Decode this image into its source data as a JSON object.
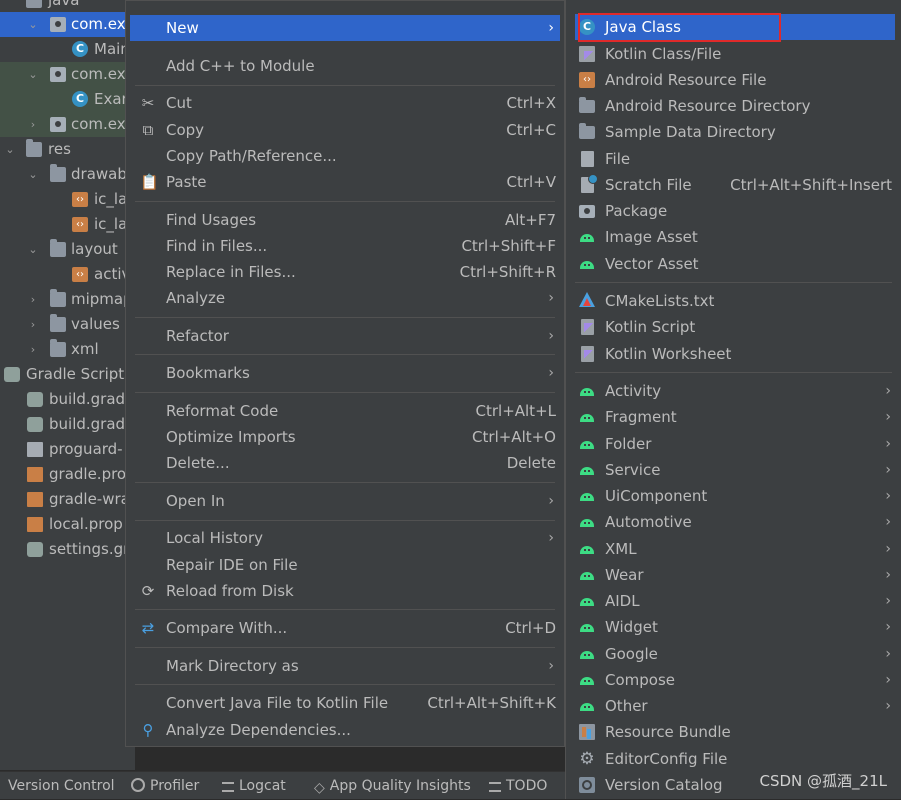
{
  "tree": {
    "rows": [
      {
        "label": "java",
        "indent": 0
      },
      {
        "label": "com.ex",
        "indent": 1
      },
      {
        "label": "Main",
        "indent": 2
      },
      {
        "label": "com.ex",
        "indent": 1
      },
      {
        "label": "Exan",
        "indent": 2
      },
      {
        "label": "com.ex",
        "indent": 1
      },
      {
        "label": "res",
        "indent": 0
      },
      {
        "label": "drawab",
        "indent": 1
      },
      {
        "label": "ic_la",
        "indent": 2
      },
      {
        "label": "ic_la",
        "indent": 2
      },
      {
        "label": "layout",
        "indent": 1
      },
      {
        "label": "activ",
        "indent": 2
      },
      {
        "label": "mipmap",
        "indent": 1
      },
      {
        "label": "values",
        "indent": 1
      },
      {
        "label": "xml",
        "indent": 1
      },
      {
        "label": "Gradle Scripts",
        "indent": 0
      },
      {
        "label": "build.grad",
        "indent": 1
      },
      {
        "label": "build.grad",
        "indent": 1
      },
      {
        "label": "proguard-",
        "indent": 1
      },
      {
        "label": "gradle.pro",
        "indent": 1
      },
      {
        "label": "gradle-wra",
        "indent": 1
      },
      {
        "label": "local.prop",
        "indent": 1
      },
      {
        "label": "settings.gr",
        "indent": 1
      }
    ]
  },
  "menu": {
    "new": "New",
    "add_cpp": "Add C++ to Module",
    "cut": "Cut",
    "cut_sc": "Ctrl+X",
    "copy": "Copy",
    "copy_sc": "Ctrl+C",
    "copy_path": "Copy Path/Reference...",
    "paste": "Paste",
    "paste_sc": "Ctrl+V",
    "find_usages": "Find Usages",
    "find_usages_sc": "Alt+F7",
    "find_in_files": "Find in Files...",
    "find_in_files_sc": "Ctrl+Shift+F",
    "replace_in_files": "Replace in Files...",
    "replace_in_files_sc": "Ctrl+Shift+R",
    "analyze": "Analyze",
    "refactor": "Refactor",
    "bookmarks": "Bookmarks",
    "reformat": "Reformat Code",
    "reformat_sc": "Ctrl+Alt+L",
    "optimize": "Optimize Imports",
    "optimize_sc": "Ctrl+Alt+O",
    "delete": "Delete...",
    "delete_sc": "Delete",
    "open_in": "Open In",
    "local_history": "Local History",
    "repair": "Repair IDE on File",
    "reload": "Reload from Disk",
    "compare": "Compare With...",
    "compare_sc": "Ctrl+D",
    "mark_dir": "Mark Directory as",
    "convert": "Convert Java File to Kotlin File",
    "convert_sc": "Ctrl+Alt+Shift+K",
    "analyze_deps": "Analyze Dependencies..."
  },
  "submenu": {
    "java_class": "Java Class",
    "kotlin_class": "Kotlin Class/File",
    "android_res_file": "Android Resource File",
    "android_res_dir": "Android Resource Directory",
    "sample_data_dir": "Sample Data Directory",
    "file": "File",
    "scratch": "Scratch File",
    "scratch_sc": "Ctrl+Alt+Shift+Insert",
    "package": "Package",
    "image_asset": "Image Asset",
    "vector_asset": "Vector Asset",
    "cmake": "CMakeLists.txt",
    "kotlin_script": "Kotlin Script",
    "kotlin_worksheet": "Kotlin Worksheet",
    "activity": "Activity",
    "fragment": "Fragment",
    "folder": "Folder",
    "service": "Service",
    "uicomponent": "UiComponent",
    "automotive": "Automotive",
    "xml": "XML",
    "wear": "Wear",
    "aidl": "AIDL",
    "widget": "Widget",
    "google": "Google",
    "compose": "Compose",
    "other": "Other",
    "resource_bundle": "Resource Bundle",
    "editorconfig": "EditorConfig File",
    "version_catalog": "Version Catalog"
  },
  "bottombar": {
    "version_control": "Version Control",
    "profiler": "Profiler",
    "logcat": "Logcat",
    "app_quality": "App Quality Insights",
    "todo": "TODO"
  },
  "watermark": "CSDN @孤酒_21L",
  "colors": {
    "selection": "#2f65ca",
    "menu_bg": "#3c3f41",
    "highlight_box": "#e02a2a",
    "android_green": "#3ddc84"
  }
}
